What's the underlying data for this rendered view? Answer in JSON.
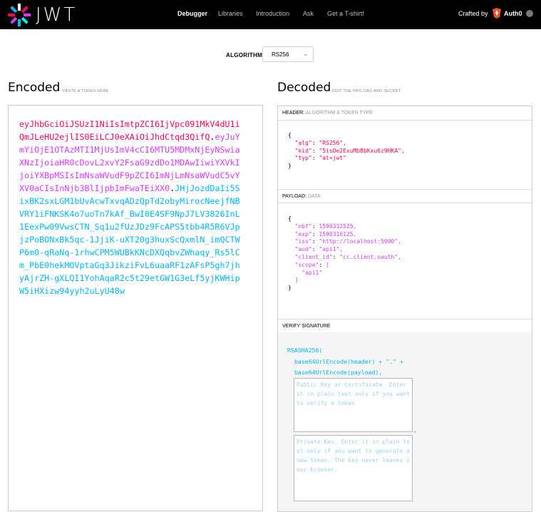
{
  "nav": {
    "logo_text": "JWT",
    "links": [
      "Debugger",
      "Libraries",
      "Introduction",
      "Ask",
      "Get a T-shirt!"
    ],
    "crafted_by": "Crafted by",
    "brand": "Auth0"
  },
  "algorithm": {
    "label": "ALGORITHM",
    "selected": "RS256"
  },
  "encoded": {
    "title": "Encoded",
    "hint": "PASTE A TOKEN HERE",
    "header_part": "eyJhbGciOiJSUzI1NiIsImtpZCI6IjVpc091MkV4dU1iQmJLeHU2ejlIS0EiLCJ0eXAiOiJhdCtqd3QifQ",
    "payload_part": "eyJuYmYiOjE1OTAzMTI1MjUsImV4cCI6MTU5MDMxNjEyNSwiaXNzIjoiaHR0cDovL2xvY2FsaG9zdDo1MDAwIiwiYXVkIjoiYXBpMSIsImNsaWVudF9pZCI6ImNjLmNsaWVudC5vYXV0aCIsInNjb3BlIjpbImFwaTEiXX0",
    "signature_part": "JHjJozdDaIi5SixBK2sxLGM1bUvAcwTxvqADzQpTd2obyMirocNeejfNBVRY1iFNKSK4o7uoTn7kAf_BwI0E4SF9NpJ7LV3826InL1EexPw09VwsCTN_Sq1u2fUzJDz9FcAPS5tbb4R5R6VJpjzPoBONxBk5qc-1JjiK-uXT20g3huxScQxmlN_imQCTWP6m0-qRaNq-1rhwCPM5WUBkKNcDXQqbvZWhaqy_Rs5lCm_PbE0hekMOVptaGq3JikziFvL6uaaRF1zAFsP5gh7jhyAjrZH-gXLQI1YohAqaR2c5t29etGW1G3eLf5yjKWHipW5iHXizw94yyh2uLyU48w",
    "dot": "."
  },
  "decoded": {
    "title": "Decoded",
    "hint": "EDIT THE PAYLOAD AND SECRET",
    "header_panel": {
      "title": "HEADER:",
      "subtitle": "ALGORITHM & TOKEN TYPE"
    },
    "header_json": [
      {
        "key": "\"alg\"",
        "value": "\"RS256\","
      },
      {
        "key": "\"kid\"",
        "value": "\"5isOe2ExuMbBbKxu6z9HKA\","
      },
      {
        "key": "\"typ\"",
        "value": "\"at+jwt\""
      }
    ],
    "payload_panel": {
      "title": "PAYLOAD:",
      "subtitle": "DATA"
    },
    "payload_json": [
      {
        "key": "\"nbf\"",
        "value": "1590312525,"
      },
      {
        "key": "\"exp\"",
        "value": "1590316125,"
      },
      {
        "key": "\"iss\"",
        "value": "\"http://localhost:5000\","
      },
      {
        "key": "\"aud\"",
        "value": "\"api1\","
      },
      {
        "key": "\"client_id\"",
        "value": "\"cc.client.oauth\","
      },
      {
        "key": "\"scope\"",
        "value": "["
      }
    ],
    "payload_scope_item": "\"api1\"",
    "signature_panel": {
      "title": "VERIFY SIGNATURE"
    },
    "signature": {
      "fn": "RSASHA256(",
      "line1": "base64UrlEncode(header) + \".\" +",
      "line2": "base64UrlEncode(payload),",
      "public_key_placeholder": "Public Key or Certificate. Enter it in plain text only if you want to verify a token",
      "private_key_placeholder": "Private Key. Enter it in plain text only if you want to generate a new token. The key never leaves your browser."
    }
  },
  "colors": {
    "header": "#fb015b",
    "payload": "#d63aff",
    "signature": "#00b9f1"
  }
}
